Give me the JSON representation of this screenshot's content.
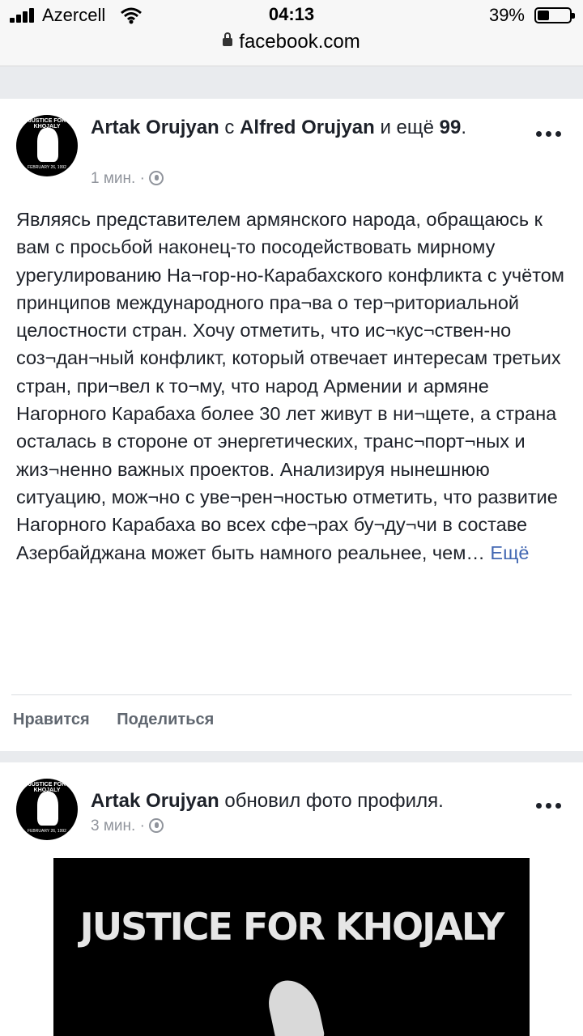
{
  "status": {
    "carrier": "Azercell",
    "time": "04:13",
    "battery": "39%"
  },
  "browser": {
    "url": "facebook.com"
  },
  "posts": [
    {
      "author": "Artak Orujyan",
      "connector": "с",
      "with": "Alfred Orujyan",
      "and_more_prefix": "и ещё",
      "and_more_count": "99",
      "time": "1 мин. ·",
      "text": "Являясь представителем армянского народа, обращаюсь к вам с просьбой наконец-то посодействовать мирному урегулированию На¬гор-но-Карабахского конфликта с учётом принципов международного пра¬ва о тер¬риториальной целостности стран. Хочу отметить, что ис¬кус¬ствен-но соз¬дан¬ный конфликт, который отвечает интересам третьих стран, при¬вел к то¬му, что народ Армении и армяне Нагорного Карабаха более 30 лет живут в ни¬щете, а страна осталась в стороне от энергетических, транс¬порт¬ных и жиз¬ненно важных проектов. Анализируя нынешнюю ситуацию, мож¬но с уве¬рен¬ностью отметить, что развитие Нагорного Карабаха во всех сфе¬рах бу¬ду¬чи в составе Азербайджана может быть намного реальнее, чем…",
      "more": "Ещё",
      "like": "Нравится",
      "share": "Поделиться"
    },
    {
      "author": "Artak Orujyan",
      "action": "обновил фото профиля.",
      "time": "3 мин. ·",
      "image_text": "JUSTICE FOR KHOJALY"
    }
  ],
  "avatar": {
    "top_text": "JUSTICE FOR KHOJALY",
    "bottom_text": "FEBRUARY 26, 1992"
  }
}
